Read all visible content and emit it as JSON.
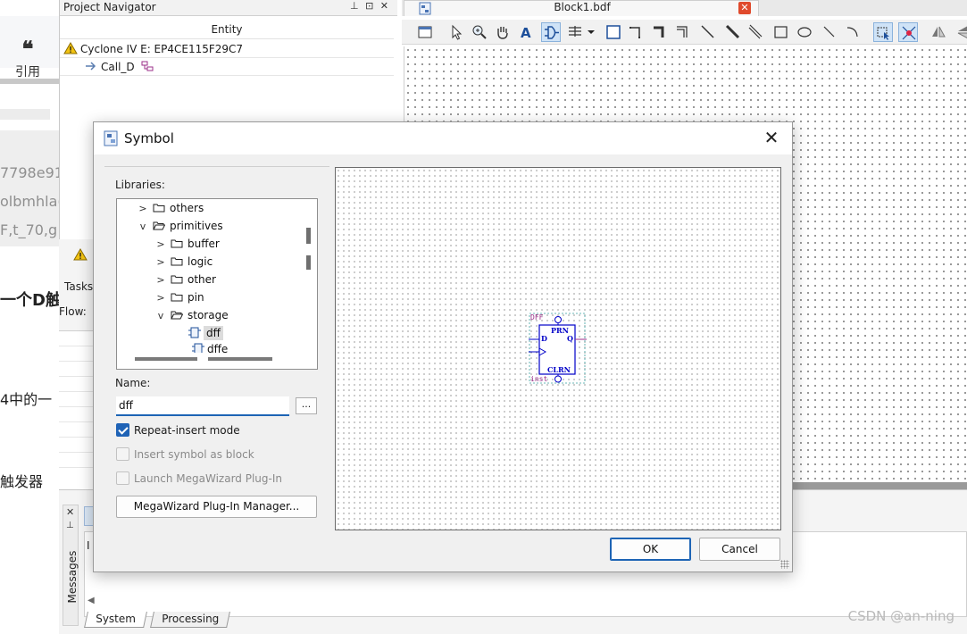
{
  "blog": {
    "quote_glyph": "❝",
    "quote_label": "引用",
    "fragments": [
      "7798e91",
      "olbmhla(",
      "F,t_70,g",
      "一个D触",
      "4中的一",
      "触发器"
    ]
  },
  "project_navigator": {
    "title": "Project Navigator",
    "title_icons": "⊥ ⊡ ✕",
    "column_header": "Entity",
    "device_row": "Cyclone IV E: EP4CE115F29C7",
    "entity_row": "Call_D",
    "tasks_label": "Tasks",
    "flow_label": "Flow:"
  },
  "editor": {
    "tab_title": "Block1.bdf",
    "tab_close": "✕"
  },
  "messages": {
    "side_label": "Messages",
    "close_glyph": "✕",
    "pin_glyph": "⊥",
    "content_fragment": "I",
    "tabs": [
      "System",
      "Processing"
    ]
  },
  "watermark": "CSDN @an-ning",
  "dialog": {
    "title": "Symbol",
    "close_glyph": "✕",
    "libraries_label": "Libraries:",
    "tree": [
      {
        "label": "others",
        "indent": 1,
        "chevron": ">",
        "type": "folder"
      },
      {
        "label": "primitives",
        "indent": 1,
        "chevron": "v",
        "type": "folder-open"
      },
      {
        "label": "buffer",
        "indent": 2,
        "chevron": ">",
        "type": "folder"
      },
      {
        "label": "logic",
        "indent": 2,
        "chevron": ">",
        "type": "folder"
      },
      {
        "label": "other",
        "indent": 2,
        "chevron": ">",
        "type": "folder"
      },
      {
        "label": "pin",
        "indent": 2,
        "chevron": ">",
        "type": "folder"
      },
      {
        "label": "storage",
        "indent": 2,
        "chevron": "v",
        "type": "folder-open"
      },
      {
        "label": "dff",
        "indent": 3,
        "chevron": "",
        "type": "symbol",
        "selected": true
      },
      {
        "label": "dffe",
        "indent": 3,
        "chevron": "",
        "type": "symbol"
      }
    ],
    "name_label": "Name:",
    "name_value": "dff",
    "browse_label": "...",
    "options": [
      {
        "label": "Repeat-insert mode",
        "checked": true,
        "enabled": true
      },
      {
        "label": "Insert symbol as block",
        "checked": false,
        "enabled": false
      },
      {
        "label": "Launch MegaWizard Plug-In",
        "checked": false,
        "enabled": false
      }
    ],
    "megawizard_button": "MegaWizard Plug-In Manager...",
    "ok_button": "OK",
    "cancel_button": "Cancel",
    "symbol_preview": {
      "type_label": "DFF",
      "instance_label": "inst",
      "pins": [
        "PRN",
        "D",
        "Q",
        "CLRN"
      ]
    }
  },
  "colors": {
    "accent": "#1d64b5",
    "symbol_pin_label": "#9b2f8a",
    "symbol_body": "#0000c8",
    "close_red": "#e04a2c"
  }
}
